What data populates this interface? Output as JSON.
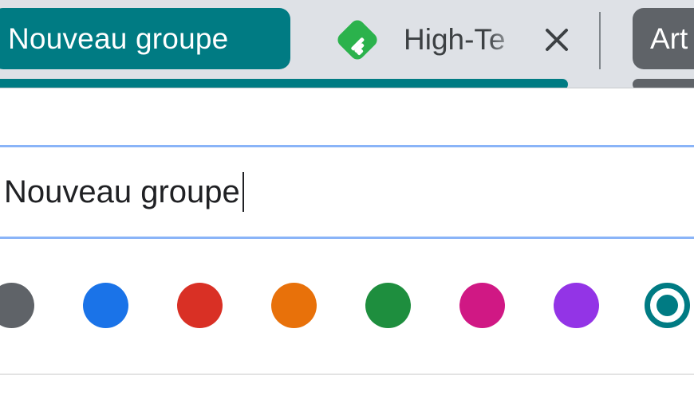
{
  "tab_strip": {
    "group_chip": {
      "label": "Nouveau groupe",
      "color": "#007b83"
    },
    "tab": {
      "title": "High-Te",
      "favicon": "feedly-icon",
      "favicon_color": "#2bb24c",
      "close_icon": "close-icon"
    },
    "next_group_chip": {
      "label": "Art",
      "color": "#5f6368"
    }
  },
  "group_editor": {
    "name_input": {
      "value": "Nouveau groupe"
    },
    "colors": [
      {
        "name": "grey",
        "hex": "#5f6368",
        "selected": false
      },
      {
        "name": "blue",
        "hex": "#1a73e8",
        "selected": false
      },
      {
        "name": "red",
        "hex": "#d93025",
        "selected": false
      },
      {
        "name": "orange",
        "hex": "#e8710a",
        "selected": false
      },
      {
        "name": "green",
        "hex": "#1e8e3e",
        "selected": false
      },
      {
        "name": "pink",
        "hex": "#d01884",
        "selected": false
      },
      {
        "name": "purple",
        "hex": "#9334e6",
        "selected": false
      },
      {
        "name": "cyan",
        "hex": "#007b83",
        "selected": true
      }
    ]
  }
}
